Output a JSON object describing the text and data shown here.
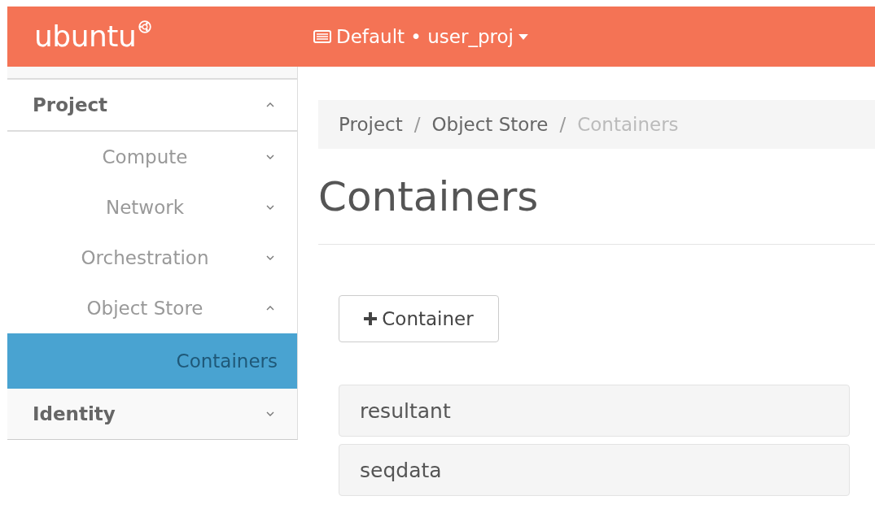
{
  "topbar": {
    "brand": "ubuntu",
    "project_selector": "Default • user_proj"
  },
  "sidebar": {
    "sections": [
      {
        "label": "Project",
        "expanded": true,
        "children": [
          {
            "label": "Compute",
            "expanded": false,
            "selected": false
          },
          {
            "label": "Network",
            "expanded": false,
            "selected": false
          },
          {
            "label": "Orchestration",
            "expanded": false,
            "selected": false
          },
          {
            "label": "Object Store",
            "expanded": true,
            "selected": false,
            "children": [
              {
                "label": "Containers",
                "selected": true
              }
            ]
          }
        ]
      },
      {
        "label": "Identity",
        "expanded": false
      }
    ]
  },
  "breadcrumb_separator": "/",
  "breadcrumb": [
    {
      "label": "Project",
      "current": false
    },
    {
      "label": "Object Store",
      "current": false
    },
    {
      "label": "Containers",
      "current": true
    }
  ],
  "page_title": "Containers",
  "create_button": "Container",
  "containers": [
    {
      "name": "resultant"
    },
    {
      "name": "seqdata"
    }
  ]
}
